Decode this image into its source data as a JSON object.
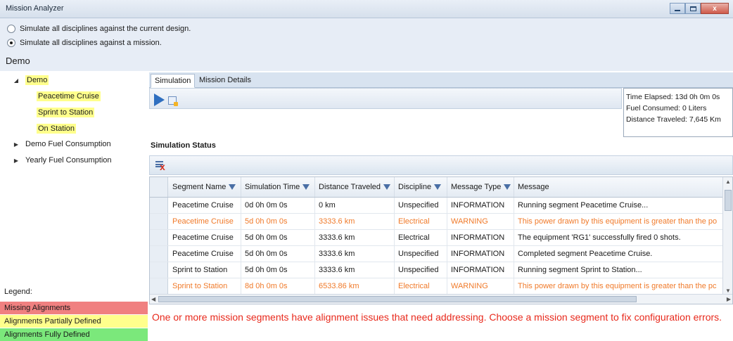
{
  "window": {
    "title": "Mission Analyzer"
  },
  "mode": {
    "option_design": "Simulate all disciplines against the current design.",
    "option_mission": "Simulate all disciplines against a mission.",
    "selected": "mission"
  },
  "demo_title": "Demo",
  "tree": {
    "root": "Demo",
    "children": [
      "Peacetime Cruise",
      "Sprint to Station",
      "On Station"
    ],
    "others": [
      "Demo Fuel Consumption",
      "Yearly Fuel Consumption"
    ]
  },
  "legend": {
    "label": "Legend:",
    "items": [
      {
        "label": "Missing Alignments",
        "color": "#f08080"
      },
      {
        "label": "Alignments Partially Defined",
        "color": "#ffff8c"
      },
      {
        "label": "Alignments Fully Defined",
        "color": "#7be87b"
      }
    ]
  },
  "tabs": [
    "Simulation",
    "Mission Details"
  ],
  "stats": {
    "time_label": "Time Elapsed:",
    "time_value": "13d 0h 0m 0s",
    "fuel_label": "Fuel Consumed:",
    "fuel_value": "0 Liters",
    "distance_label": "Distance Traveled:",
    "distance_value": "7,645 Km"
  },
  "status": {
    "title": "Simulation Status",
    "columns": [
      "Segment Name",
      "Simulation Time",
      "Distance Traveled",
      "Discipline",
      "Message Type",
      "Message"
    ],
    "rows": [
      {
        "segment": "Peacetime Cruise",
        "time": "0d 0h 0m 0s",
        "distance": "0 km",
        "discipline": "Unspecified",
        "type": "INFORMATION",
        "message": "Running segment Peacetime Cruise...",
        "warn": false
      },
      {
        "segment": "Peacetime Cruise",
        "time": "5d 0h 0m 0s",
        "distance": "3333.6 km",
        "discipline": "Electrical",
        "type": "WARNING",
        "message": "This power drawn by this equipment is greater than the po",
        "warn": true
      },
      {
        "segment": "Peacetime Cruise",
        "time": "5d 0h 0m 0s",
        "distance": "3333.6 km",
        "discipline": "Electrical",
        "type": "INFORMATION",
        "message": "The equipment 'RG1' successfully fired 0 shots.",
        "warn": false
      },
      {
        "segment": "Peacetime Cruise",
        "time": "5d 0h 0m 0s",
        "distance": "3333.6 km",
        "discipline": "Unspecified",
        "type": "INFORMATION",
        "message": "Completed segment Peacetime Cruise.",
        "warn": false
      },
      {
        "segment": "Sprint to Station",
        "time": "5d 0h 0m 0s",
        "distance": "3333.6 km",
        "discipline": "Unspecified",
        "type": "INFORMATION",
        "message": "Running segment Sprint to Station...",
        "warn": false
      },
      {
        "segment": "Sprint to Station",
        "time": "8d 0h 0m 0s",
        "distance": "6533.86 km",
        "discipline": "Electrical",
        "type": "WARNING",
        "message": "This power drawn by this equipment is greater than the pc",
        "warn": true
      }
    ]
  },
  "error_message": "One or more mission segments have alignment issues that need addressing. Choose a mission segment to fix configuration errors.",
  "colors": {
    "warning_text": "#f07a2a",
    "error_text": "#e8291c",
    "highlight": "#ffff8c"
  }
}
